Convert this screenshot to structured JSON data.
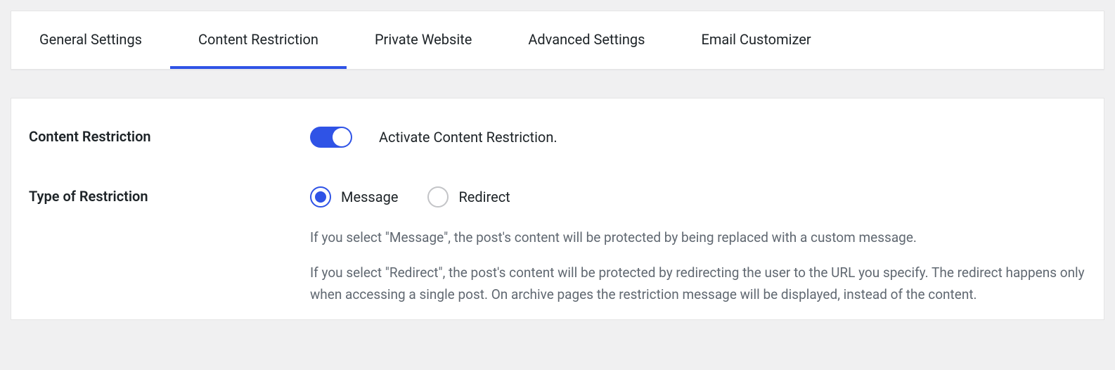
{
  "tabs": {
    "general": "General Settings",
    "content_restriction": "Content Restriction",
    "private_website": "Private Website",
    "advanced": "Advanced Settings",
    "email_customizer": "Email Customizer"
  },
  "fields": {
    "content_restriction": {
      "label": "Content Restriction",
      "toggle_label": "Activate Content Restriction."
    },
    "type_of_restriction": {
      "label": "Type of Restriction",
      "option_message": "Message",
      "option_redirect": "Redirect",
      "help_message": "If you select \"Message\", the post's content will be protected by being replaced with a custom message.",
      "help_redirect": "If you select \"Redirect\", the post's content will be protected by redirecting the user to the URL you specify. The redirect happens only when accessing a single post. On archive pages the restriction message will be displayed, instead of the content."
    }
  }
}
